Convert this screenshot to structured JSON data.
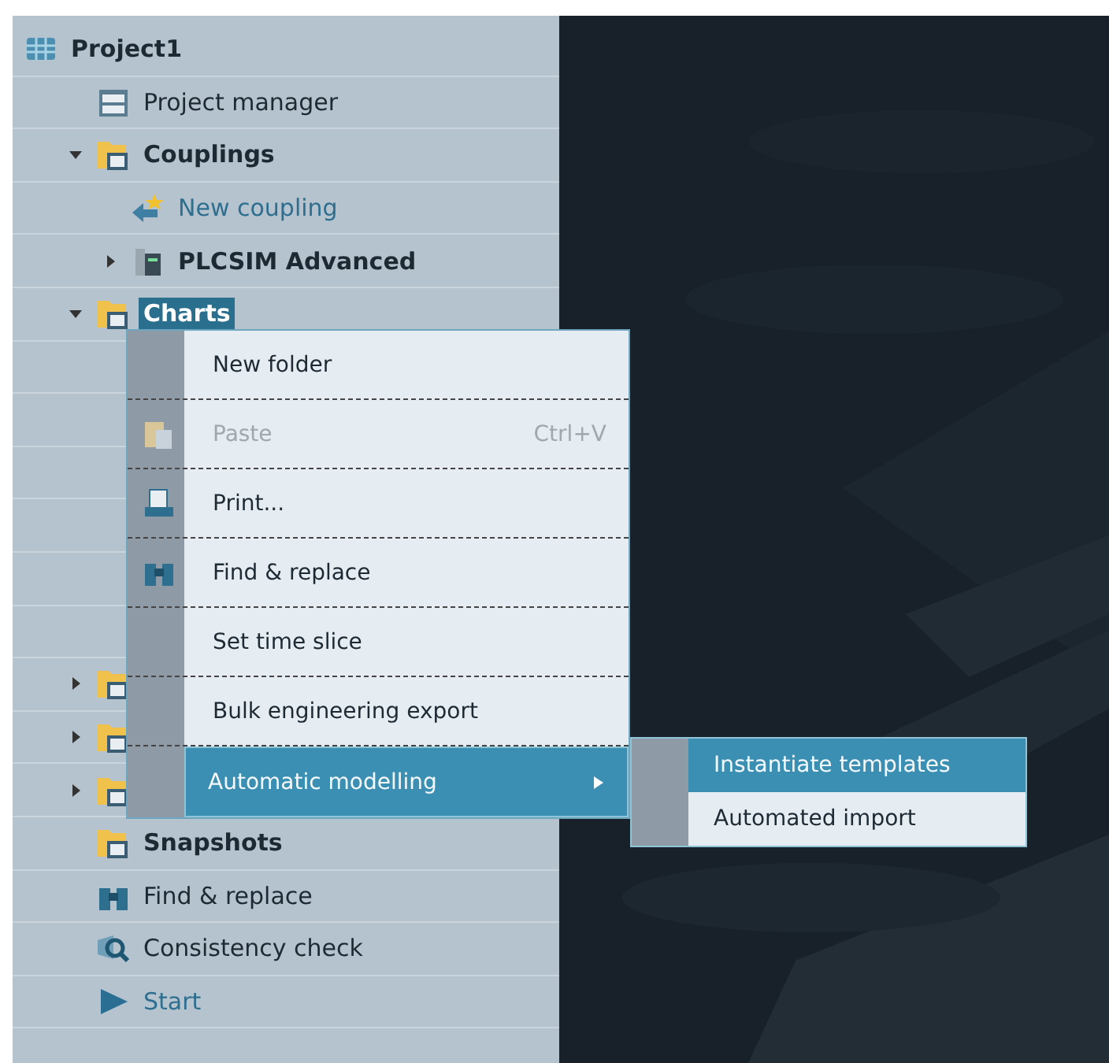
{
  "tree": [
    {
      "label": "Project1",
      "kind": "cube",
      "children": [
        {
          "label": "Project manager",
          "kind": "list"
        },
        {
          "label": "Couplings",
          "kind": "folder",
          "expanded": true,
          "children": [
            {
              "label": "New coupling",
              "kind": "arrow"
            },
            {
              "label": "PLCSIM Advanced",
              "kind": "device",
              "expanded": false
            }
          ]
        },
        {
          "label": "Charts",
          "kind": "folder",
          "expanded": true,
          "selected": true
        },
        {
          "kind": "folder",
          "expanded": false
        },
        {
          "kind": "folder",
          "expanded": false
        },
        {
          "kind": "folder",
          "expanded": false
        },
        {
          "label": "Snapshots",
          "kind": "folder"
        },
        {
          "label": "Find & replace",
          "kind": "binoculars"
        },
        {
          "label": "Consistency check",
          "kind": "magnifier"
        },
        {
          "label": "Start",
          "kind": "play"
        }
      ]
    }
  ],
  "context_menu": {
    "items": [
      {
        "label": "New folder",
        "disabled": false,
        "selected": false
      },
      {
        "label": "Paste",
        "kind": "clipboard",
        "shortcut": "Ctrl+V",
        "disabled": true,
        "selected": false
      },
      {
        "label": "Print...",
        "kind": "printer",
        "disabled": false,
        "selected": false
      },
      {
        "label": "Find & replace",
        "kind": "binoculars",
        "disabled": false,
        "selected": false
      },
      {
        "label": "Set time slice",
        "disabled": false,
        "selected": false
      },
      {
        "label": "Bulk engineering export",
        "disabled": false,
        "selected": false
      },
      {
        "label": "Automatic modelling",
        "submenu": true,
        "disabled": false,
        "selected": true
      }
    ]
  },
  "submenu": {
    "items": [
      {
        "label": "Instantiate templates",
        "selected": true
      },
      {
        "label": "Automated import",
        "selected": false
      }
    ]
  }
}
